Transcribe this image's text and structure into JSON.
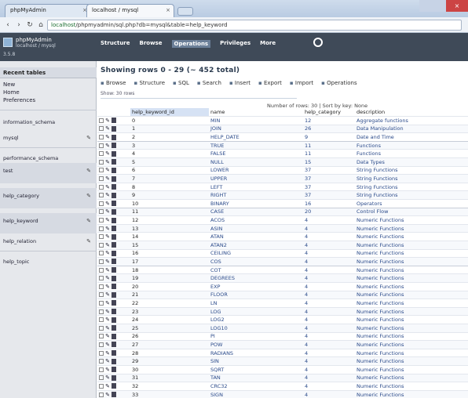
{
  "browser": {
    "tab1_label": "phpMyAdmin",
    "tab2_label": "localhost / mysql",
    "close_glyph": "×",
    "url_host": "localhost",
    "url_path": "/phpmyadmin/sql.php?db=mysql&table=help_keyword"
  },
  "app": {
    "brand_title": "phpMyAdmin",
    "brand_subtitle": "localhost / mysql",
    "brand_version": "3.5.8",
    "nav": [
      "Structure",
      "Browse",
      "Operations",
      "Privileges",
      "More"
    ]
  },
  "sidebar": {
    "header": "Recent tables",
    "links": [
      "New",
      "Home",
      "Preferences"
    ],
    "sections": [
      "information_schema",
      "mysql",
      "performance_schema",
      "test",
      "help_category",
      "help_keyword",
      "help_relation",
      "help_topic"
    ]
  },
  "main": {
    "title": "Showing rows 0 - 29 (~ 452 total)",
    "toolbar": [
      "Browse",
      "Structure",
      "SQL",
      "Search",
      "Insert",
      "Export",
      "Import",
      "Operations"
    ],
    "subbar": "Show: 30 rows",
    "pager": "Number of rows: 30 | Sort by key: None",
    "columns": [
      "help_keyword_id",
      "name",
      "help_category",
      "description"
    ],
    "rows": [
      [
        "0",
        "MIN",
        "12",
        "Aggregate functions"
      ],
      [
        "1",
        "JOIN",
        "26",
        "Data Manipulation"
      ],
      [
        "2",
        "HELP_DATE",
        "9",
        "Date and Time"
      ],
      [
        "3",
        "TRUE",
        "11",
        "Functions"
      ],
      [
        "4",
        "FALSE",
        "11",
        "Functions"
      ],
      [
        "5",
        "NULL",
        "15",
        "Data Types"
      ],
      [
        "6",
        "LOWER",
        "37",
        "String Functions"
      ],
      [
        "7",
        "UPPER",
        "37",
        "String Functions"
      ],
      [
        "8",
        "LEFT",
        "37",
        "String Functions"
      ],
      [
        "9",
        "RIGHT",
        "37",
        "String Functions"
      ],
      [
        "10",
        "BINARY",
        "16",
        "Operators"
      ],
      [
        "11",
        "CASE",
        "20",
        "Control Flow"
      ],
      [
        "12",
        "ACOS",
        "4",
        "Numeric Functions"
      ],
      [
        "13",
        "ASIN",
        "4",
        "Numeric Functions"
      ],
      [
        "14",
        "ATAN",
        "4",
        "Numeric Functions"
      ],
      [
        "15",
        "ATAN2",
        "4",
        "Numeric Functions"
      ],
      [
        "16",
        "CEILING",
        "4",
        "Numeric Functions"
      ],
      [
        "17",
        "COS",
        "4",
        "Numeric Functions"
      ],
      [
        "18",
        "COT",
        "4",
        "Numeric Functions"
      ],
      [
        "19",
        "DEGREES",
        "4",
        "Numeric Functions"
      ],
      [
        "20",
        "EXP",
        "4",
        "Numeric Functions"
      ],
      [
        "21",
        "FLOOR",
        "4",
        "Numeric Functions"
      ],
      [
        "22",
        "LN",
        "4",
        "Numeric Functions"
      ],
      [
        "23",
        "LOG",
        "4",
        "Numeric Functions"
      ],
      [
        "24",
        "LOG2",
        "4",
        "Numeric Functions"
      ],
      [
        "25",
        "LOG10",
        "4",
        "Numeric Functions"
      ],
      [
        "26",
        "PI",
        "4",
        "Numeric Functions"
      ],
      [
        "27",
        "POW",
        "4",
        "Numeric Functions"
      ],
      [
        "28",
        "RADIANS",
        "4",
        "Numeric Functions"
      ],
      [
        "29",
        "SIN",
        "4",
        "Numeric Functions"
      ],
      [
        "30",
        "SQRT",
        "4",
        "Numeric Functions"
      ],
      [
        "31",
        "TAN",
        "4",
        "Numeric Functions"
      ],
      [
        "32",
        "CRC32",
        "4",
        "Numeric Functions"
      ],
      [
        "33",
        "SIGN",
        "4",
        "Numeric Functions"
      ]
    ]
  }
}
